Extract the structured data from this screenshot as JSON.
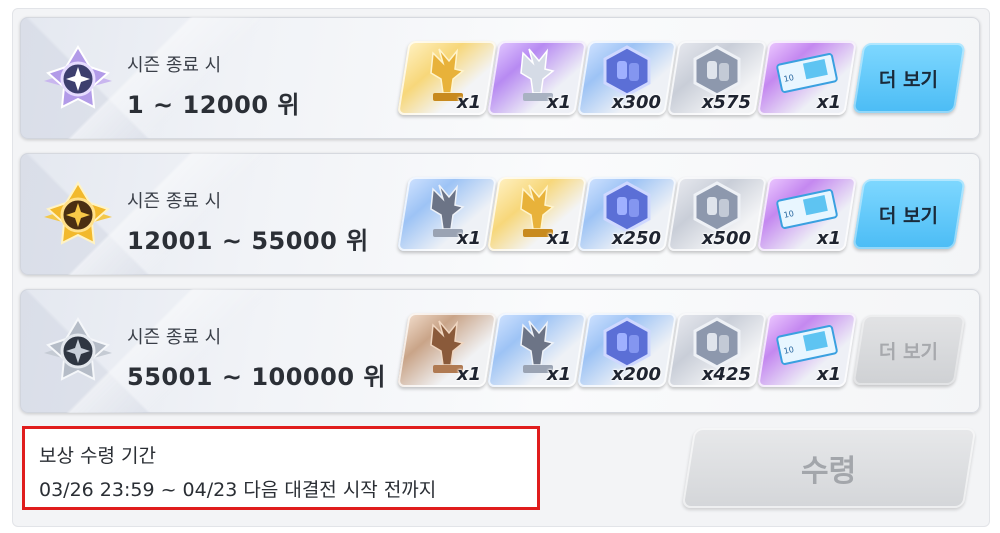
{
  "tiers": [
    {
      "label": "시즌 종료 시",
      "range": "1 ~ 12000 위",
      "badge": "purple-star-badge-icon",
      "more_label": "더 보기",
      "more_enabled": true,
      "rewards": [
        {
          "icon": "gold-trophy-icon",
          "qty": "x1"
        },
        {
          "icon": "silver-trophy-icon",
          "qty": "x1"
        },
        {
          "icon": "blue-gem-hexagon-icon",
          "qty": "x300"
        },
        {
          "icon": "silver-gem-hexagon-icon",
          "qty": "x575"
        },
        {
          "icon": "ticket-10-icon",
          "qty": "x1"
        }
      ]
    },
    {
      "label": "시즌 종료 시",
      "range": "12001 ~ 55000 위",
      "badge": "gold-star-badge-icon",
      "more_label": "더 보기",
      "more_enabled": true,
      "rewards": [
        {
          "icon": "silver-trophy-icon",
          "qty": "x1"
        },
        {
          "icon": "gold-trophy-icon",
          "qty": "x1"
        },
        {
          "icon": "blue-gem-hexagon-icon",
          "qty": "x250"
        },
        {
          "icon": "silver-gem-hexagon-icon",
          "qty": "x500"
        },
        {
          "icon": "ticket-10-icon",
          "qty": "x1"
        }
      ]
    },
    {
      "label": "시즌 종료 시",
      "range": "55001 ~ 100000 위",
      "badge": "silver-star-badge-icon",
      "more_label": "더 보기",
      "more_enabled": false,
      "rewards": [
        {
          "icon": "bronze-trophy-icon",
          "qty": "x1"
        },
        {
          "icon": "silver-trophy-icon",
          "qty": "x1"
        },
        {
          "icon": "blue-gem-hexagon-icon",
          "qty": "x200"
        },
        {
          "icon": "silver-gem-hexagon-icon",
          "qty": "x425"
        },
        {
          "icon": "ticket-10-icon",
          "qty": "x1"
        }
      ]
    }
  ],
  "claim_period": {
    "title": "보상 수령 기간",
    "dates": "03/26 23:59 ~ 04/23 다음 대결전 시작 전까지",
    "highlight_color": "#e01d1d"
  },
  "claim_button": {
    "label": "수령",
    "enabled": false
  },
  "colors": {
    "more_button": "#4bbcf5",
    "disabled": "#d4d6d9"
  }
}
